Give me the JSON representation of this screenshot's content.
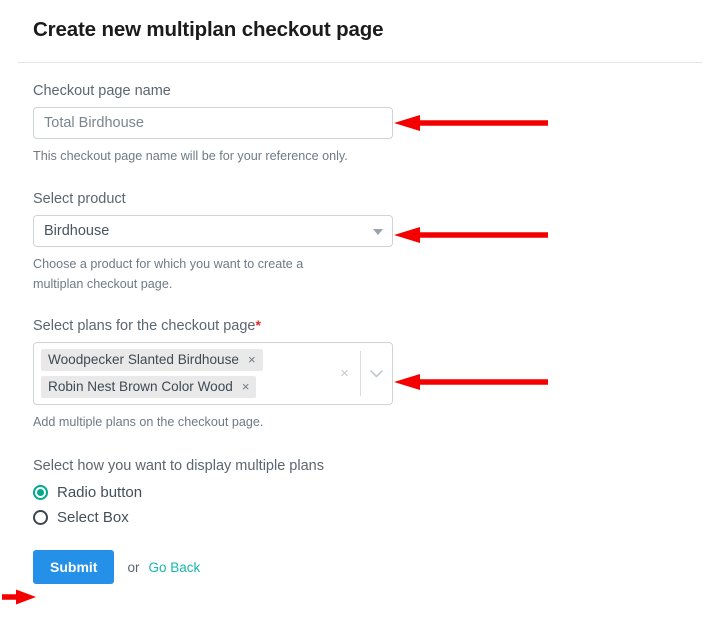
{
  "header": {
    "title": "Create new multiplan checkout page"
  },
  "form": {
    "checkout_name": {
      "label": "Checkout page name",
      "value": "Total Birdhouse",
      "placeholder": "Total Birdhouse",
      "help": "This checkout page name will be for your reference only."
    },
    "product": {
      "label": "Select product",
      "value": "Birdhouse",
      "help": "Choose a product for which you want to create a multiplan checkout page.",
      "caret_icon": "caret-down-icon"
    },
    "plans": {
      "label": "Select plans for the checkout page",
      "required_marker": "*",
      "chips": [
        {
          "label": "Woodpecker Slanted Birdhouse",
          "remove_icon": "×"
        },
        {
          "label": "Robin Nest Brown Color Wood",
          "remove_icon": "×"
        }
      ],
      "clear_icon": "×",
      "dropdown_icon": "chevron-down-icon",
      "help": "Add multiple plans on the checkout page."
    },
    "display_mode": {
      "label": "Select how you want to display multiple plans",
      "options": [
        {
          "label": "Radio button",
          "selected": true
        },
        {
          "label": "Select Box",
          "selected": false
        }
      ]
    }
  },
  "footer": {
    "submit_label": "Submit",
    "or_label": "or",
    "go_back_label": "Go Back"
  },
  "colors": {
    "accent_blue": "#2490e8",
    "accent_teal": "#00a88e",
    "link_teal": "#17b6b0",
    "required_red": "#e02b2b",
    "annotation_red": "#f50000",
    "border": "#cfd4d9",
    "chip_bg": "#e9e9e9",
    "label_text": "#5c6670"
  },
  "annotations": {
    "arrow_color": "#f50000",
    "arrows": [
      {
        "name": "arrow-to-checkout-name-input",
        "direction": "left"
      },
      {
        "name": "arrow-to-product-select",
        "direction": "left"
      },
      {
        "name": "arrow-to-plans-multiselect",
        "direction": "left"
      },
      {
        "name": "arrow-to-submit-button",
        "direction": "right"
      }
    ]
  }
}
